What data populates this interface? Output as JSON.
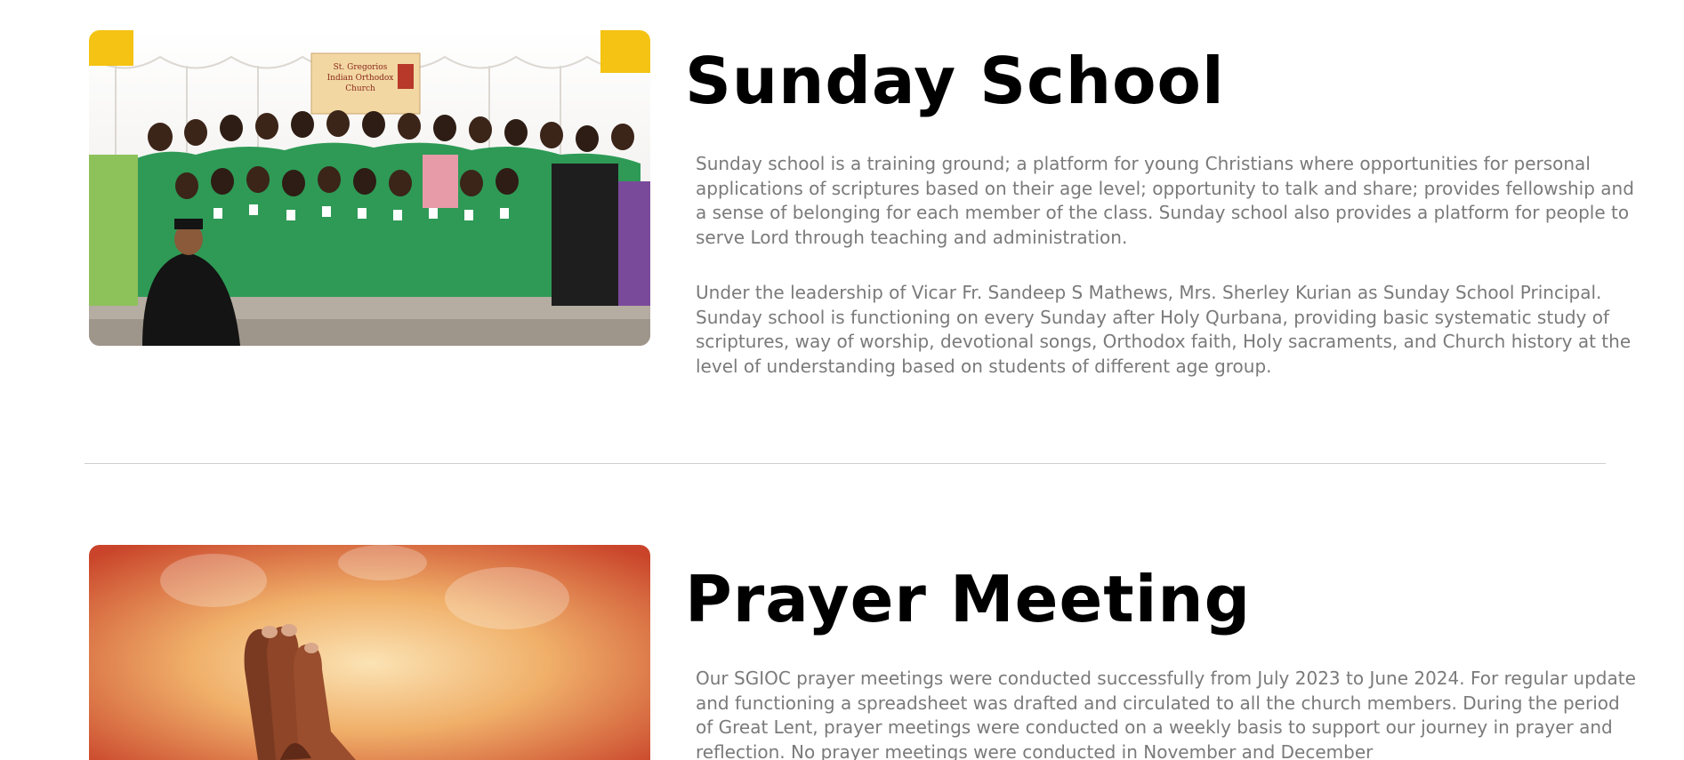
{
  "sunday_school": {
    "title": "Sunday School",
    "paragraphs": [
      "Sunday school is a training ground; a platform for young Christians where opportunities for personal applications of scriptures based on their age level; opportunity to talk and share; provides fellowship and a sense of belonging for each member of the class. Sunday school also provides a platform for people to serve Lord through teaching and administration.",
      "Under the leadership of Vicar Fr. Sandeep S Mathews, Mrs. Sherley Kurian as Sunday School Principal. Sunday school is functioning on every Sunday after Holy Qurbana, providing basic systematic study of scriptures, way of worship, devotional songs, Orthodox faith, Holy sacraments, and Church history at the level of understanding based on students of different age group."
    ],
    "photo": {
      "banner_lines": [
        "St. Gregorios",
        "Indian Orthodox",
        "Church"
      ],
      "colors": {
        "curtain": "#f4f2f0",
        "shirts": "#2e9a56",
        "banner": "#f2d7a3",
        "flags": "#f4c313"
      }
    }
  },
  "prayer_meeting": {
    "title": "Prayer Meeting",
    "paragraphs": [
      "Our SGIOC prayer meetings were conducted successfully from July 2023 to June 2024. For regular update and functioning a spreadsheet was drafted and circulated to all the church members. During the period of Great Lent, prayer meetings were conducted on a weekly basis to support our journey in prayer and reflection. No prayer meetings were conducted in November and December"
    ],
    "photo": {
      "icon": "praying-hands-icon",
      "colors": {
        "glow": "#f6c98a",
        "outer": "#c9442a",
        "hands": "#7a3a22"
      }
    }
  },
  "colors": {
    "heading": "#000000",
    "body_text": "#7a7a7a",
    "divider": "#cfcfcf",
    "background": "#ffffff"
  }
}
